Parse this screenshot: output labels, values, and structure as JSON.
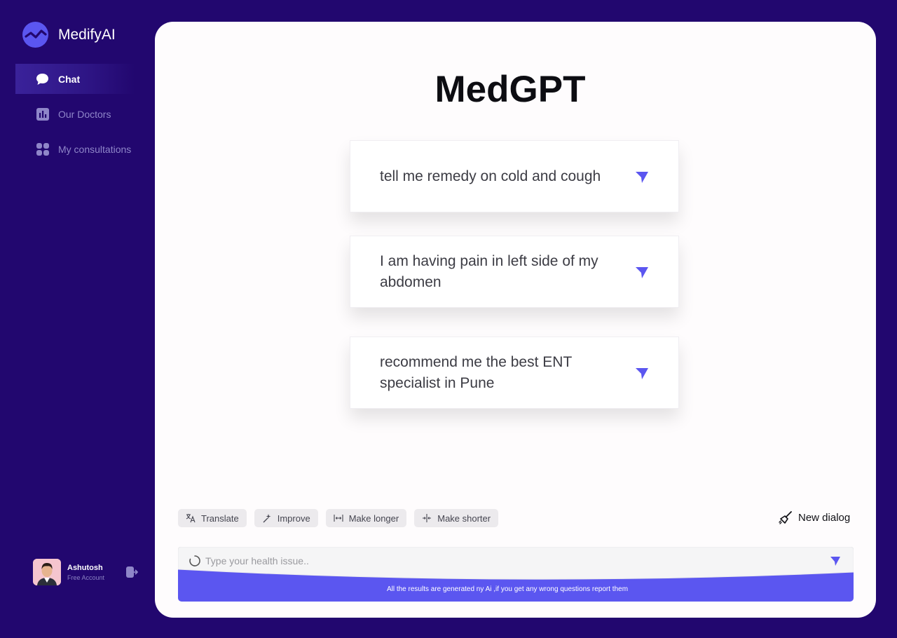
{
  "app": {
    "name": "MedifyAI"
  },
  "sidebar": {
    "items": [
      {
        "label": "Chat",
        "icon": "chat-bubble-icon",
        "active": true
      },
      {
        "label": "Our Doctors",
        "icon": "bar-chart-icon",
        "active": false
      },
      {
        "label": "My consultations",
        "icon": "grid-icon",
        "active": false
      }
    ]
  },
  "user": {
    "name": "Ashutosh",
    "plan": "Free Account"
  },
  "main": {
    "title": "MedGPT",
    "suggestions": [
      {
        "text": "tell me remedy on cold and cough"
      },
      {
        "text": "I am having pain in left side of my abdomen"
      },
      {
        "text": "recommend me the best ENT specialist in Pune"
      }
    ],
    "actions": [
      {
        "label": "Translate",
        "icon": "translate-icon"
      },
      {
        "label": "Improve",
        "icon": "sparkle-icon"
      },
      {
        "label": "Make longer",
        "icon": "expand-icon"
      },
      {
        "label": "Make shorter",
        "icon": "shrink-icon"
      }
    ],
    "new_dialog_label": "New dialog",
    "input": {
      "placeholder": "Type your health issue..",
      "value": ""
    },
    "disclaimer": "All the results are generated ny Ai ,if you get any wrong questions report them"
  },
  "colors": {
    "background": "#22076f",
    "accent": "#5b56f0",
    "panel": "#fefcfd"
  }
}
